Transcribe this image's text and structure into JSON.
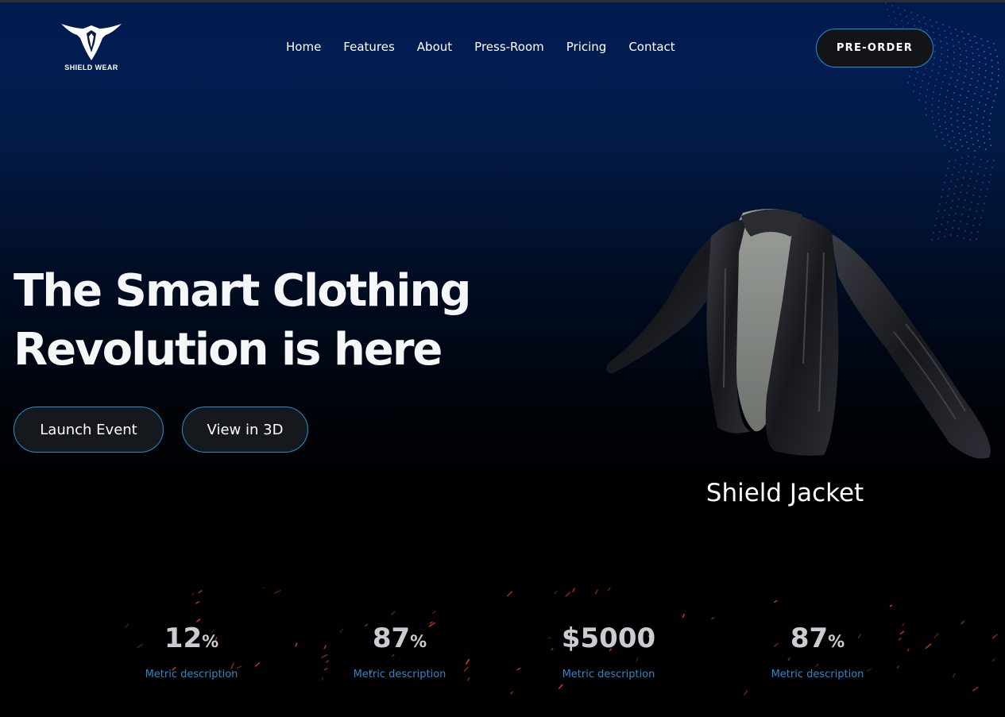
{
  "brand": {
    "name": "SHIELD WEAR",
    "logo_icon": "eagle-shield-icon"
  },
  "nav": {
    "items": [
      {
        "label": "Home"
      },
      {
        "label": "Features"
      },
      {
        "label": "About"
      },
      {
        "label": "Press-Room"
      },
      {
        "label": "Pricing"
      },
      {
        "label": "Contact"
      }
    ]
  },
  "header": {
    "cta_label": "PRE-ORDER"
  },
  "hero": {
    "headline_line1": "The Smart Clothing",
    "headline_line2": "Revolution is here",
    "buttons": {
      "launch_label": "Launch Event",
      "view3d_label": "View in 3D"
    }
  },
  "product": {
    "name": "Shield Jacket",
    "image_icon": "leather-jacket-icon"
  },
  "metrics": [
    {
      "value": "12",
      "unit": "%",
      "description": "Metric description"
    },
    {
      "value": "87",
      "unit": "%",
      "description": "Metric description"
    },
    {
      "value": "$5000",
      "unit": "",
      "description": "Metric description"
    },
    {
      "value": "87",
      "unit": "%",
      "description": "Metric description"
    }
  ],
  "colors": {
    "accent_border": "#1f8fcf",
    "metric_desc": "#2e86c8",
    "background_top": "#001a4d",
    "background_bottom": "#000000",
    "spark": "#e0431f"
  }
}
